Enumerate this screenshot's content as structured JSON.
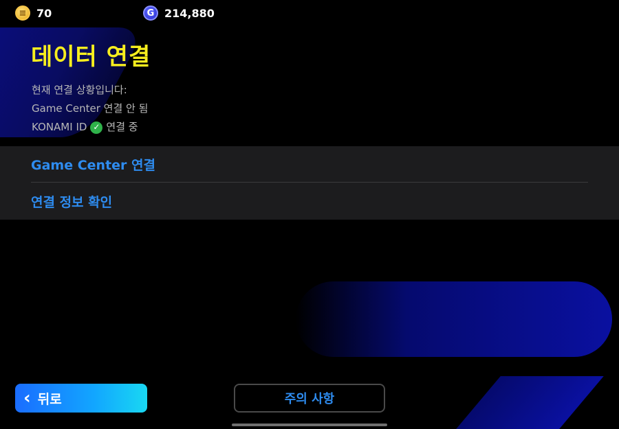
{
  "header": {
    "gold_coin": {
      "icon": "gold-coin-icon",
      "value": "70"
    },
    "gp": {
      "icon": "gp-coin-icon",
      "value": "214,880"
    }
  },
  "title": "데이터 연결",
  "status": {
    "intro": "현재 연결 상황입니다:",
    "game_center": "Game Center 연결 안 됨",
    "konami_label": "KONAMI ID",
    "konami_state": "연결 중"
  },
  "menu": {
    "items": [
      {
        "label": "Game Center 연결"
      },
      {
        "label": "연결 정보 확인"
      }
    ]
  },
  "footer": {
    "back_label": "뒤로",
    "notice_label": "주의 사항"
  },
  "colors": {
    "title": "#f7ee1e",
    "link": "#2e8cf0",
    "check": "#2fb24a"
  }
}
